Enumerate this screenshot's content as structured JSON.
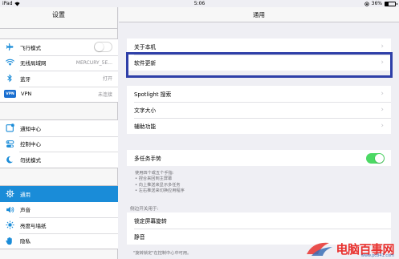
{
  "status_bar": {
    "carrier": "iPad",
    "time": "5:06",
    "battery": "36%",
    "battery_level": 0.36
  },
  "sidebar": {
    "title": "设置",
    "groups": [
      [
        {
          "label": "飞行模式",
          "icon": "airplane-icon",
          "icon_color": "#ffffff",
          "control": "toggle-off"
        },
        {
          "label": "无线局域网",
          "icon": "wifi-icon",
          "icon_color": "#ffffff",
          "value": "MERCURY_5E..."
        },
        {
          "label": "蓝牙",
          "icon": "bluetooth-icon",
          "icon_color": "#ffffff",
          "value": "打开"
        },
        {
          "label": "VPN",
          "icon": "vpn-icon",
          "icon_color": "#1a6fd0",
          "value": "未连接"
        }
      ],
      [
        {
          "label": "通知中心",
          "icon": "notification-center-icon"
        },
        {
          "label": "控制中心",
          "icon": "control-center-icon"
        },
        {
          "label": "勿扰模式",
          "icon": "moon-icon"
        }
      ],
      [
        {
          "label": "通用",
          "icon": "gear-icon",
          "active": true
        },
        {
          "label": "声音",
          "icon": "speaker-icon"
        },
        {
          "label": "亮度与墙纸",
          "icon": "brightness-icon"
        },
        {
          "label": "隐私",
          "icon": "hand-icon"
        }
      ]
    ]
  },
  "main": {
    "title": "通用",
    "group1": [
      "关于本机",
      "软件更新"
    ],
    "group2": [
      "Spotlight 搜索",
      "文字大小",
      "辅助功能"
    ],
    "multitask": {
      "label": "多任务手势",
      "enabled": true
    },
    "multitask_footer": [
      "使用四个或五个手指:",
      "• 捏合来回到主屏幕",
      "• 向上推送来显示多任务",
      "• 左右推送来切换应用程序"
    ],
    "side_switch_header": "侧边开关用于:",
    "side_switch_options": [
      "锁定屏幕旋转",
      "静音"
    ],
    "side_switch_footer": "\"旋转锁定\"在控制中心中可用。"
  },
  "watermark": {
    "text": "电脑百事网",
    "sub": "www.pc841.com"
  },
  "colors": {
    "accent": "#1a8cd8",
    "toggle_on": "#4cd964",
    "highlight_border": "#2e3fa8"
  }
}
